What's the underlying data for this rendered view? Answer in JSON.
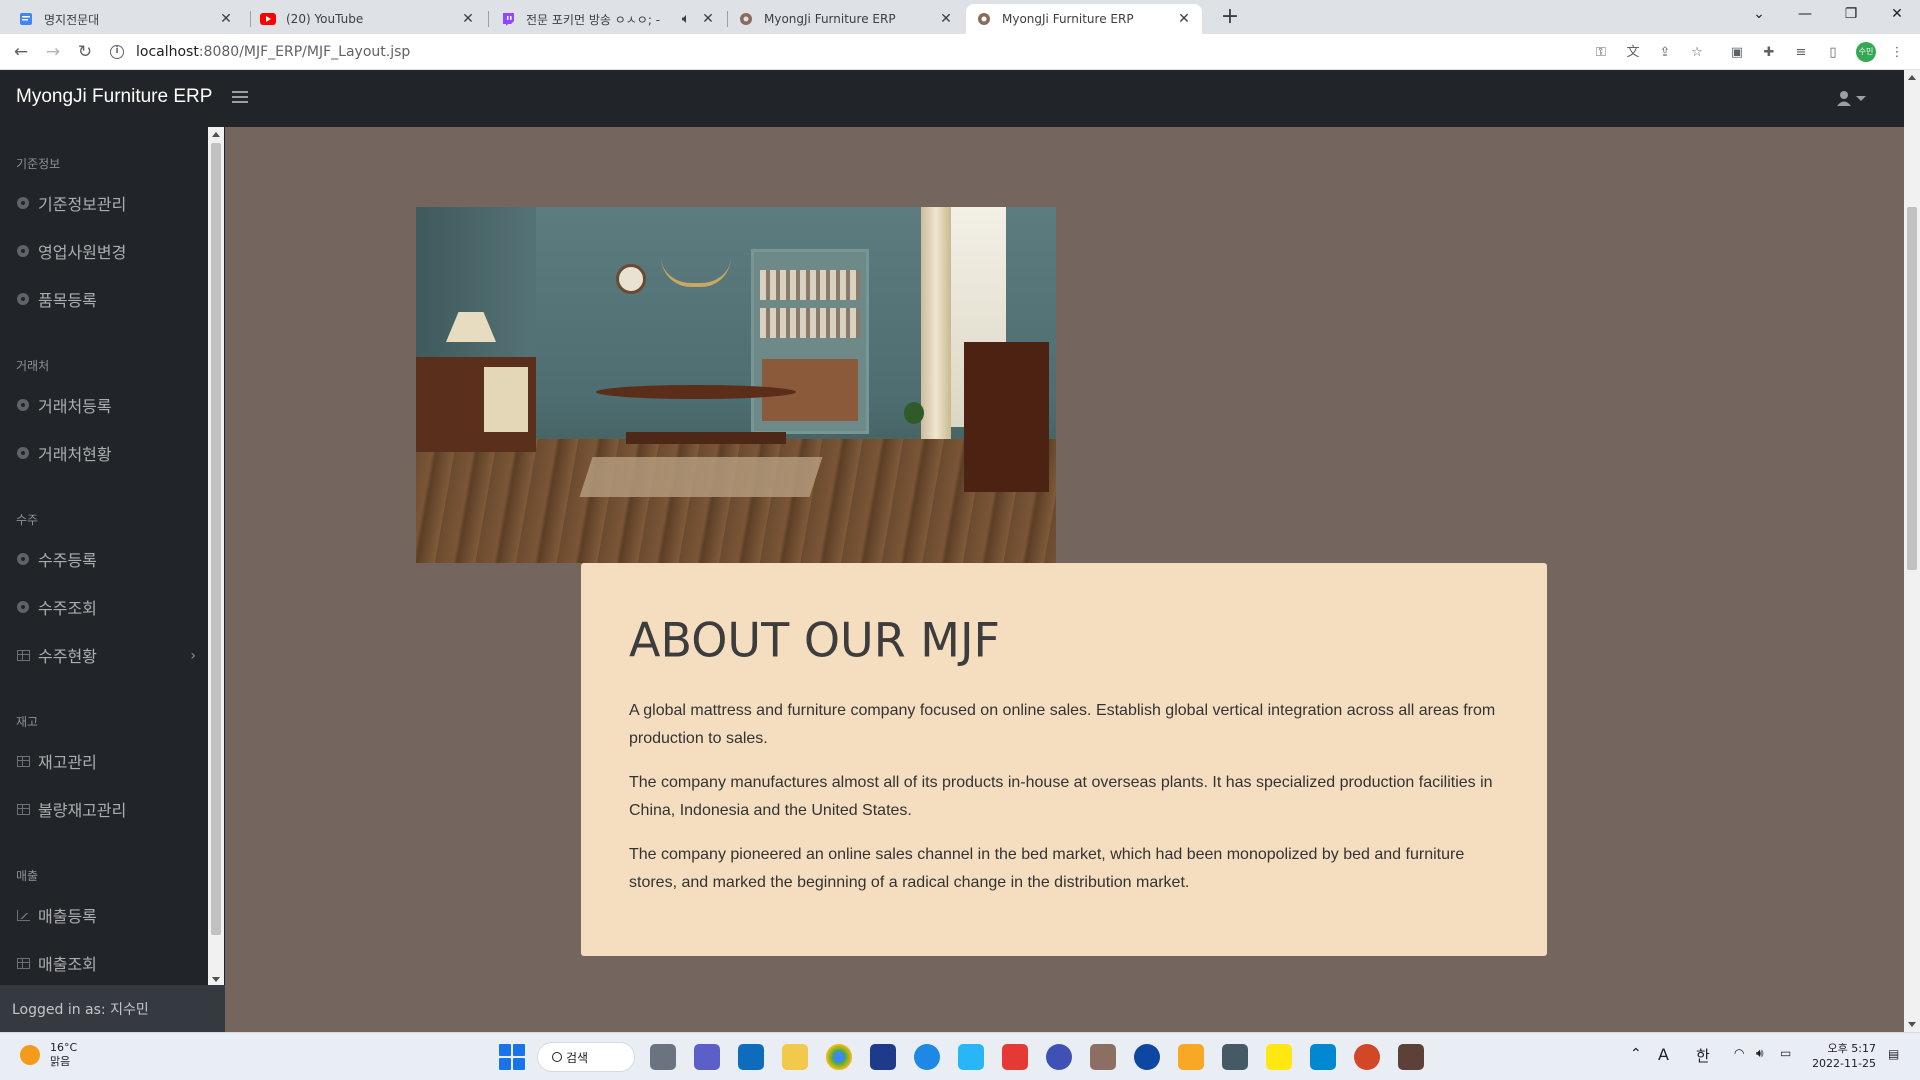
{
  "browser": {
    "tabs": [
      {
        "title": "명지전문대",
        "icon": "doc-icon",
        "color": "#4285f4"
      },
      {
        "title": "(20) YouTube",
        "icon": "youtube-icon",
        "color": "#ff0000"
      },
      {
        "title": "전문 포키먼 방송 ㅇㅅㅇ; -",
        "icon": "twitch-icon",
        "color": "#9146ff",
        "audio": "speaker-icon"
      },
      {
        "title": "MyongJi Furniture ERP",
        "icon": "app-icon",
        "color": "#8a6a5a"
      },
      {
        "title": "MyongJi Furniture ERP",
        "icon": "app-icon",
        "color": "#8a6a5a",
        "active": true
      }
    ],
    "url_host": "localhost",
    "url_rest": ":8080/MJF_ERP/MJF_Layout.jsp",
    "profile_initials": "수민"
  },
  "app": {
    "brand": "MyongJi Furniture ERP",
    "sidebar": {
      "sections": [
        {
          "heading": "기준정보",
          "items": [
            {
              "label": "기준정보관리",
              "icon": "gear-icon"
            },
            {
              "label": "영업사원변경",
              "icon": "gear-icon"
            },
            {
              "label": "품목등록",
              "icon": "gear-icon"
            }
          ]
        },
        {
          "heading": "거래처",
          "items": [
            {
              "label": "거래처등록",
              "icon": "gear-icon"
            },
            {
              "label": "거래처현황",
              "icon": "gear-icon"
            }
          ]
        },
        {
          "heading": "수주",
          "items": [
            {
              "label": "수주등록",
              "icon": "gear-icon"
            },
            {
              "label": "수주조회",
              "icon": "gear-icon"
            },
            {
              "label": "수주현황",
              "icon": "table-icon",
              "expandable": true
            }
          ]
        },
        {
          "heading": "재고",
          "items": [
            {
              "label": "재고관리",
              "icon": "table-icon"
            },
            {
              "label": "불량재고관리",
              "icon": "table-icon"
            }
          ]
        },
        {
          "heading": "매출",
          "items": [
            {
              "label": "매출등록",
              "icon": "chart-icon"
            },
            {
              "label": "매출조회",
              "icon": "table-icon"
            }
          ]
        }
      ],
      "footer": "Logged in as: 지수민"
    },
    "about": {
      "title": "ABOUT OUR MJF",
      "paragraphs": [
        "A global mattress and furniture company focused on online sales. Establish global vertical integration across all areas from production to sales.",
        "The company manufactures almost all of its products in-house at overseas plants. It has specialized production facilities in China, Indonesia and the United States.",
        "The company pioneered an online sales channel in the bed market, which had been monopolized by bed and furniture stores, and marked the beginning of a radical change in the distribution market."
      ]
    }
  },
  "taskbar": {
    "weather_temp": "16°C",
    "weather_desc": "맑음",
    "search_label": "검색",
    "ime_a": "A",
    "ime_lang": "한",
    "time": "오후 5:17",
    "date": "2022-11-25"
  },
  "colors": {
    "content_bg": "#75655f",
    "card_bg": "#f5dec0",
    "nav_bg": "#212529"
  }
}
